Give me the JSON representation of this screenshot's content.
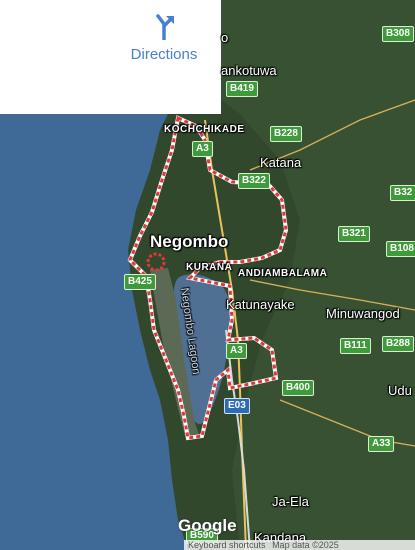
{
  "directions": {
    "label": "Directions",
    "icon": "directions-icon",
    "color": "#4a7fd0"
  },
  "places": {
    "negombo": "Negombo",
    "kochchikade": "KOCHCHIKADE",
    "kurana": "KURANA",
    "andiambalama": "ANDIAMBALAMA",
    "katana": "Katana",
    "katunayake": "Katunayake",
    "minuwangoda": "Minuwangod",
    "ja_ela": "Ja-Ela",
    "kandana": "Kandana",
    "udu": "Udu",
    "ankotuwa": "ankotuwa",
    "top_o": "o",
    "lagoon": "Negombo Lagoon"
  },
  "road_shields": {
    "b308": "B308",
    "b419": "B419",
    "a3_north": "A3",
    "b228": "B228",
    "b322": "B322",
    "b32": "B32",
    "b321": "B321",
    "b108": "B108",
    "b425": "B425",
    "b111": "B111",
    "b288": "B288",
    "a3_south": "A3",
    "b400": "B400",
    "e03": "E03",
    "a33": "A33",
    "b590": "B590"
  },
  "logo": "Google",
  "attribution": {
    "shortcuts": "Keyboard shortcuts",
    "map_data": "Map data ©2025"
  },
  "colors": {
    "sea": "#3f6a97",
    "land": "#2f4a2c",
    "boundary": "#e0383a",
    "road_green": "#3e9a3a",
    "road_blue": "#2e6bb5"
  }
}
